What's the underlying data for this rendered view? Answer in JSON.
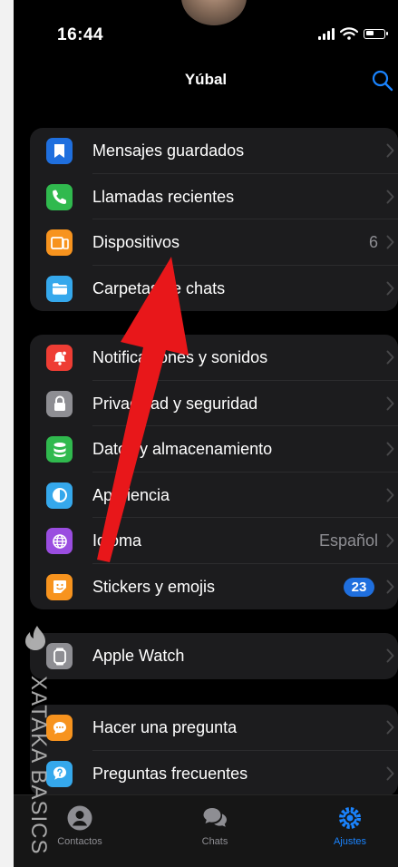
{
  "status_bar": {
    "time": "16:44"
  },
  "nav": {
    "title": "Yúbal"
  },
  "groups": [
    {
      "rows": [
        {
          "label": "Mensajes guardados",
          "icon": "bookmark-icon",
          "color": "#1f6fde"
        },
        {
          "label": "Llamadas recientes",
          "icon": "phone-icon",
          "color": "#30b94e"
        },
        {
          "label": "Dispositivos",
          "icon": "devices-icon",
          "color": "#f7931e",
          "detail": "6"
        },
        {
          "label": "Carpetas de chats",
          "icon": "folder-icon",
          "color": "#35a8ec"
        }
      ]
    },
    {
      "rows": [
        {
          "label": "Notificaciones y sonidos",
          "icon": "bell-icon",
          "color": "#ee3d34"
        },
        {
          "label": "Privacidad y seguridad",
          "icon": "lock-icon",
          "color": "#8e8e93"
        },
        {
          "label": "Datos y almacenamiento",
          "icon": "database-icon",
          "color": "#30b94e"
        },
        {
          "label": "Apariencia",
          "icon": "appearance-icon",
          "color": "#35a8ec"
        },
        {
          "label": "Idioma",
          "icon": "globe-icon",
          "color": "#9a4de0",
          "detail": "Español"
        },
        {
          "label": "Stickers y emojis",
          "icon": "sticker-icon",
          "color": "#f7931e",
          "badge": "23"
        }
      ]
    },
    {
      "rows": [
        {
          "label": "Apple Watch",
          "icon": "watch-icon",
          "color": "#8e8e93"
        }
      ]
    },
    {
      "rows": [
        {
          "label": "Hacer una pregunta",
          "icon": "chat-bubble-icon",
          "color": "#f7931e"
        },
        {
          "label": "Preguntas frecuentes",
          "icon": "question-icon",
          "color": "#35a8ec"
        }
      ]
    }
  ],
  "tabs": [
    {
      "label": "Contactos",
      "icon": "person-icon"
    },
    {
      "label": "Chats",
      "icon": "chats-icon"
    },
    {
      "label": "Ajustes",
      "icon": "gear-icon",
      "active": true
    }
  ],
  "watermark": {
    "text": "XATAKA BASICS"
  },
  "colors": {
    "accent": "#1a84ff",
    "arrow": "#e8171a"
  }
}
